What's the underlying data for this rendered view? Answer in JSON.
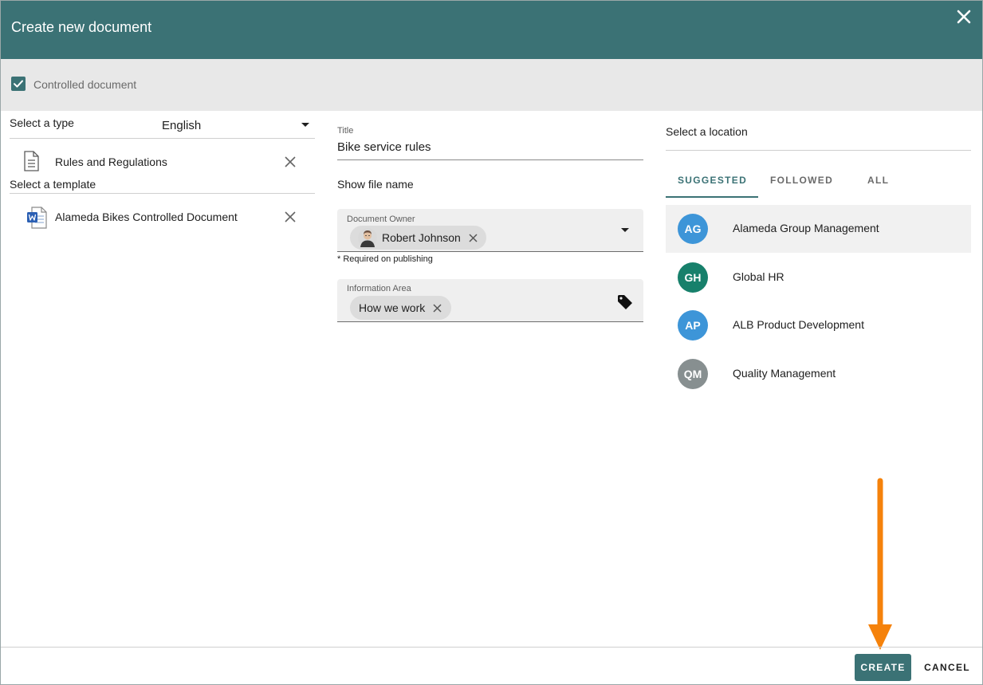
{
  "dialog": {
    "title": "Create new document",
    "controlled_label": "Controlled document",
    "controlled_checked": true
  },
  "left": {
    "type_label": "Select a type",
    "language_value": "English",
    "type_value": "Rules and Regulations",
    "template_label": "Select a template",
    "template_value": "Alameda Bikes Controlled Document"
  },
  "middle": {
    "title_label": "Title",
    "title_value": "Bike service rules",
    "show_file_name": "Show file name",
    "owner_label": "Document Owner",
    "owner_value": "Robert Johnson",
    "required_note": "* Required on publishing",
    "info_area_label": "Information Area",
    "info_area_value": "How we work"
  },
  "right": {
    "location_label": "Select a location",
    "tabs": [
      {
        "label": "SUGGESTED",
        "active": true
      },
      {
        "label": "FOLLOWED",
        "active": false
      },
      {
        "label": "ALL",
        "active": false
      }
    ],
    "locations": [
      {
        "initials": "AG",
        "name": "Alameda Group Management",
        "color": "#3d95d8"
      },
      {
        "initials": "GH",
        "name": "Global HR",
        "color": "#17806b"
      },
      {
        "initials": "AP",
        "name": "ALB Product Development",
        "color": "#3d95d8"
      },
      {
        "initials": "QM",
        "name": "Quality Management",
        "color": "#878f90"
      }
    ]
  },
  "footer": {
    "create_label": "CREATE",
    "cancel_label": "CANCEL"
  },
  "colors": {
    "header": "#3b7275",
    "accent": "#3b7275",
    "arrow": "#f5820b"
  }
}
